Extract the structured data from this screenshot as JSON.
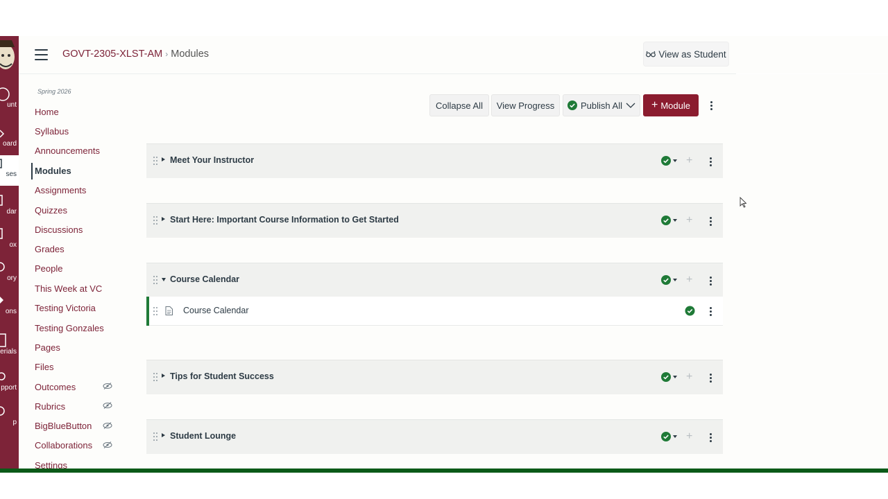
{
  "breadcrumb": {
    "course": "GOVT-2305-XLST-AM",
    "current": "Modules"
  },
  "header": {
    "view_as_student": "View as Student"
  },
  "global_nav": {
    "items": [
      {
        "label": "unt",
        "icon": "account-icon"
      },
      {
        "label": "oard",
        "icon": "dashboard-icon"
      },
      {
        "label": "ses",
        "icon": "courses-icon"
      },
      {
        "label": "dar",
        "icon": "calendar-icon"
      },
      {
        "label": "ox",
        "icon": "inbox-icon"
      },
      {
        "label": "ory",
        "icon": "history-icon"
      },
      {
        "label": "ons",
        "icon": "commons-icon"
      },
      {
        "label": "terials",
        "icon": "materials-icon"
      },
      {
        "label": "pport",
        "icon": "support-icon"
      },
      {
        "label": "p",
        "icon": "help-icon"
      }
    ]
  },
  "course_nav": {
    "term": "Spring 2026",
    "items": [
      {
        "label": "Home"
      },
      {
        "label": "Syllabus"
      },
      {
        "label": "Announcements"
      },
      {
        "label": "Modules"
      },
      {
        "label": "Assignments"
      },
      {
        "label": "Quizzes"
      },
      {
        "label": "Discussions"
      },
      {
        "label": "Grades"
      },
      {
        "label": "People"
      },
      {
        "label": "This Week at VC"
      },
      {
        "label": "Testing Victoria"
      },
      {
        "label": "Testing Gonzales"
      },
      {
        "label": "Pages"
      },
      {
        "label": "Files"
      },
      {
        "label": "Outcomes",
        "hidden_icon": "eye-slash-icon"
      },
      {
        "label": "Rubrics",
        "hidden_icon": "eye-slash-icon"
      },
      {
        "label": "BigBlueButton",
        "hidden_icon": "eye-slash-icon"
      },
      {
        "label": "Collaborations",
        "hidden_icon": "eye-slash-icon"
      },
      {
        "label": "Settings"
      }
    ]
  },
  "toolbar": {
    "collapse_all": "Collapse All",
    "view_progress": "View Progress",
    "publish_all": "Publish All",
    "add_module": "Module"
  },
  "modules": [
    {
      "title": "Meet Your Instructor",
      "expanded": false
    },
    {
      "title": "Start Here: Important Course Information to Get Started",
      "expanded": false
    },
    {
      "title": "Course Calendar",
      "expanded": true,
      "items": [
        {
          "title": "Course Calendar",
          "type": "page",
          "published": true
        }
      ]
    },
    {
      "title": "Tips for Student Success",
      "expanded": false
    },
    {
      "title": "Student Lounge",
      "expanded": false
    }
  ],
  "colors": {
    "brand": "#7d2338",
    "published": "#1f7a37",
    "accent_bar": "#0b5a18"
  }
}
